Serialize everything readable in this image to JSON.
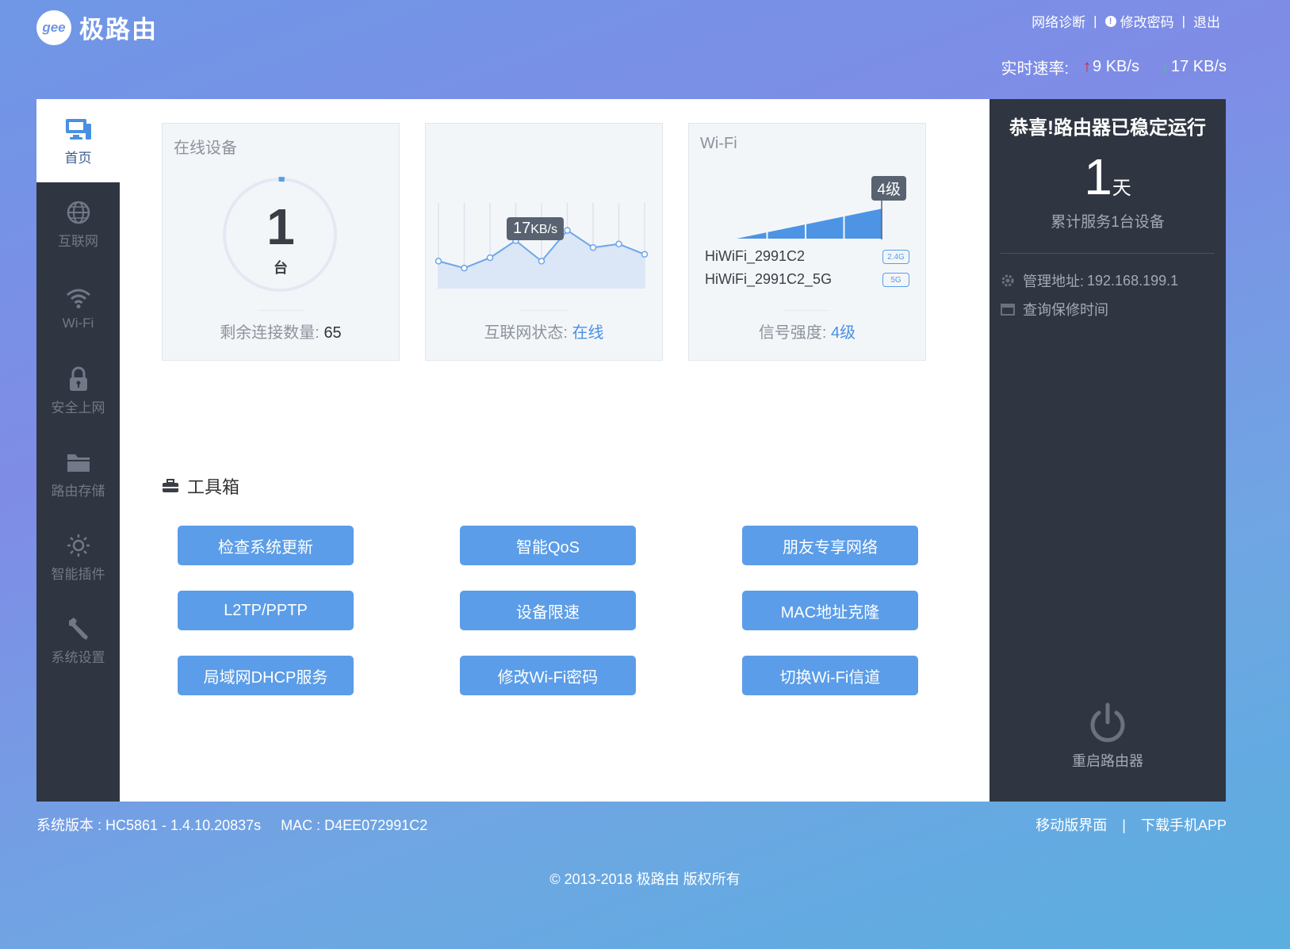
{
  "brand": {
    "logo_text": "gee",
    "name": "极路由"
  },
  "header": {
    "links": {
      "diagnose": "网络诊断",
      "change_password": "修改密码",
      "logout": "退出",
      "separator": "|"
    },
    "speed": {
      "label": "实时速率:",
      "upload": "9 KB/s",
      "download": "17 KB/s",
      "up_arrow": "↑",
      "down_arrow": "↓"
    }
  },
  "sidebar": {
    "items": [
      {
        "label": "首页",
        "icon": "monitor-icon",
        "active": true
      },
      {
        "label": "互联网",
        "icon": "globe-icon"
      },
      {
        "label": "Wi-Fi",
        "icon": "wifi-icon"
      },
      {
        "label": "安全上网",
        "icon": "lock-icon"
      },
      {
        "label": "路由存储",
        "icon": "folder-icon"
      },
      {
        "label": "智能插件",
        "icon": "sun-icon"
      },
      {
        "label": "系统设置",
        "icon": "wrench-icon"
      }
    ]
  },
  "cards": {
    "devices": {
      "title": "在线设备",
      "count": "1",
      "unit": "台",
      "remaining_label": "剩余连接数量:",
      "remaining_value": "65",
      "ring_fill_fraction": 0.01
    },
    "internet": {
      "speed_value": "17",
      "speed_unit": "KB/s",
      "status_label": "互联网状态:",
      "status_value": "在线"
    },
    "wifi": {
      "title": "Wi-Fi",
      "level_badge": "4级",
      "networks": [
        {
          "ssid": "HiWiFi_2991C2",
          "band": "2.4G"
        },
        {
          "ssid": "HiWiFi_2991C2_5G",
          "band": "5G"
        }
      ],
      "signal_label": "信号强度:",
      "signal_value": "4级",
      "signal_level": 4,
      "signal_max": 4
    }
  },
  "toolbox": {
    "title": "工具箱",
    "buttons": [
      "检查系统更新",
      "智能QoS",
      "朋友专享网络",
      "L2TP/PPTP",
      "设备限速",
      "MAC地址克隆",
      "局域网DHCP服务",
      "修改Wi-Fi密码",
      "切换Wi-Fi信道"
    ]
  },
  "status_panel": {
    "title": "恭喜!路由器已稳定运行",
    "days": "1",
    "days_unit": "天",
    "subtitle": "累计服务1台设备",
    "admin_label": "管理地址:",
    "admin_value": "192.168.199.1",
    "warranty": "查询保修时间",
    "reboot": "重启路由器"
  },
  "footer": {
    "version": "系统版本 : HC5861 - 1.4.10.20837s",
    "mac": "MAC : D4EE072991C2",
    "mobile": "移动版界面",
    "separator": "|",
    "app": "下载手机APP",
    "copyright": "© 2013-2018 极路由 版权所有"
  },
  "colors": {
    "accent": "#5b9de8",
    "dark": "#2f3541",
    "link_blue": "#4a90e2",
    "up": "#e11d2e",
    "down": "#3fd06a"
  },
  "chart_data": {
    "type": "area",
    "title": "",
    "x": [
      0,
      1,
      2,
      3,
      4,
      5,
      6,
      7,
      8
    ],
    "series": [
      {
        "values": [
          8,
          6,
          9,
          14,
          8,
          17,
          12,
          13,
          10
        ]
      }
    ],
    "xlabel": "",
    "ylabel": "",
    "ylim": [
      0,
      25
    ],
    "grid": true
  }
}
